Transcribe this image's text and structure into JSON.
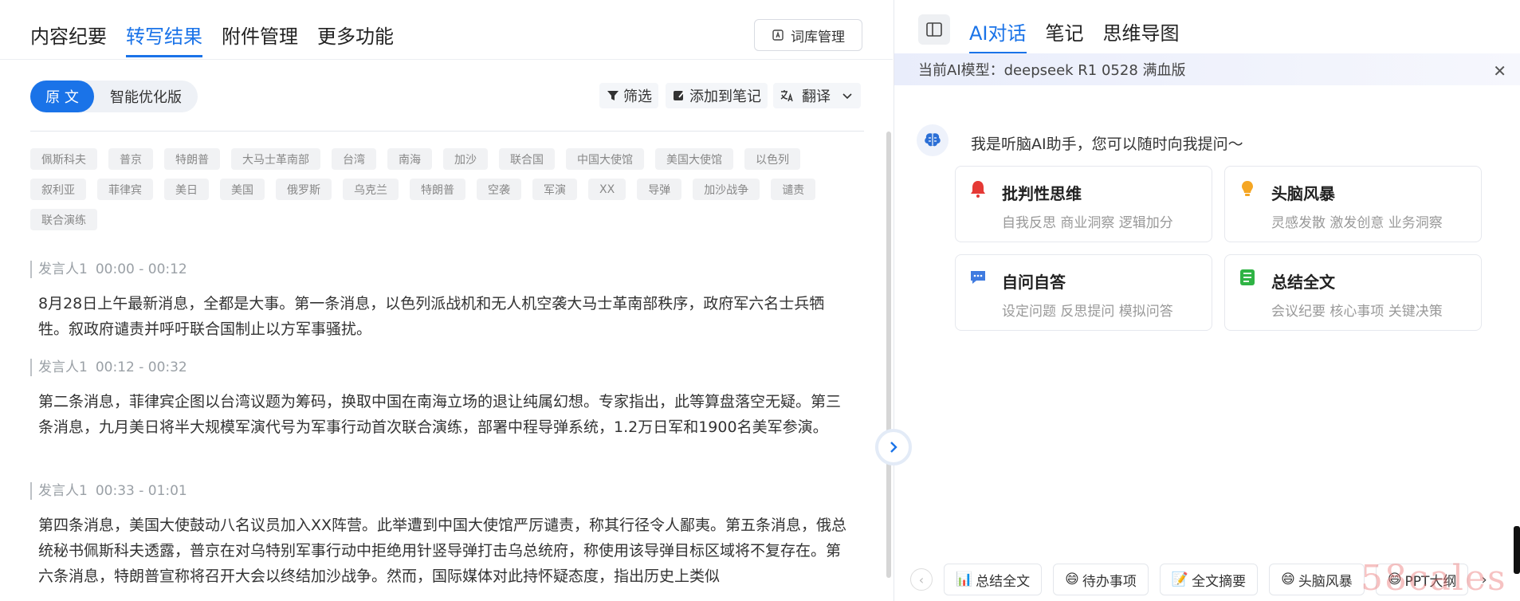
{
  "left": {
    "tabs": [
      {
        "label": "内容纪要",
        "active": false
      },
      {
        "label": "转写结果",
        "active": true
      },
      {
        "label": "附件管理",
        "active": false
      },
      {
        "label": "更多功能",
        "active": false
      }
    ],
    "lexicon_button": "词库管理",
    "toggle": {
      "original": "原 文",
      "optimized": "智能优化版"
    },
    "tools": {
      "filter": "筛选",
      "add_to_notes": "添加到笔记",
      "translate": "翻译"
    },
    "keywords": [
      "佩斯科夫",
      "普京",
      "特朗普",
      "大马士革南部",
      "台湾",
      "南海",
      "加沙",
      "联合国",
      "中国大使馆",
      "美国大使馆",
      "以色列",
      "叙利亚",
      "菲律宾",
      "美日",
      "美国",
      "俄罗斯",
      "乌克兰",
      "特朗普",
      "空袭",
      "军演",
      "XX",
      "导弹",
      "加沙战争",
      "谴责",
      "联合演练"
    ],
    "segments": [
      {
        "speaker": "发言人1",
        "time": "00:00 - 00:12",
        "text": "8月28日上午最新消息，全都是大事。第一条消息，以色列派战机和无人机空袭大马士革南部秩序，政府军六名士兵牺牲。叙政府谴责并呼吁联合国制止以方军事骚扰。"
      },
      {
        "speaker": "发言人1",
        "time": "00:12 - 00:32",
        "text": "第二条消息，菲律宾企图以台湾议题为筹码，换取中国在南海立场的退让纯属幻想。专家指出，此等算盘落空无疑。第三条消息，九月美日将半大规模军演代号为军事行动首次联合演练，部署中程导弹系统，1.2万日军和1900名美军参演。"
      },
      {
        "speaker": "发言人1",
        "time": "00:33 - 01:01",
        "text": "第四条消息，美国大使鼓动八名议员加入XX阵营。此举遭到中国大使馆严厉谴责，称其行径令人鄙夷。第五条消息，俄总统秘书佩斯科夫透露，普京在对乌特别军事行动中拒绝用针竖导弹打击乌总统府，称使用该导弹目标区域将不复存在。第六条消息，特朗普宣称将召开大会以终结加沙战争。然而，国际媒体对此持怀疑态度，指出历史上类似"
      }
    ]
  },
  "right": {
    "tabs": [
      {
        "label": "AI对话",
        "active": true
      },
      {
        "label": "笔记",
        "active": false
      },
      {
        "label": "思维导图",
        "active": false
      }
    ],
    "model_bar": "当前AI模型：deepseek R1 0528 满血版",
    "greeting": "我是听脑AI助手，您可以随时向我提问～",
    "cards": [
      {
        "title": "批判性思维",
        "subtitle": "自我反思 商业洞察 逻辑加分",
        "icon": "bell-icon",
        "color": "#e53935"
      },
      {
        "title": "头脑风暴",
        "subtitle": "灵感发散 激发创意 业务洞察",
        "icon": "bulb-icon",
        "color": "#f5a623"
      },
      {
        "title": "自问自答",
        "subtitle": "设定问题 反思提问 模拟问答",
        "icon": "chat-icon",
        "color": "#3f7be0"
      },
      {
        "title": "总结全文",
        "subtitle": "会议纪要 核心事项 关键决策",
        "icon": "list-icon",
        "color": "#2fb344"
      }
    ],
    "quick_actions": [
      {
        "label": "总结全文",
        "emoji": "📊"
      },
      {
        "label": "待办事项",
        "emoji": "😄"
      },
      {
        "label": "全文摘要",
        "emoji": "📝"
      },
      {
        "label": "头脑风暴",
        "emoji": "😄"
      },
      {
        "label": "PPT大纲",
        "emoji": "😄"
      }
    ],
    "watermark": "58cales"
  }
}
